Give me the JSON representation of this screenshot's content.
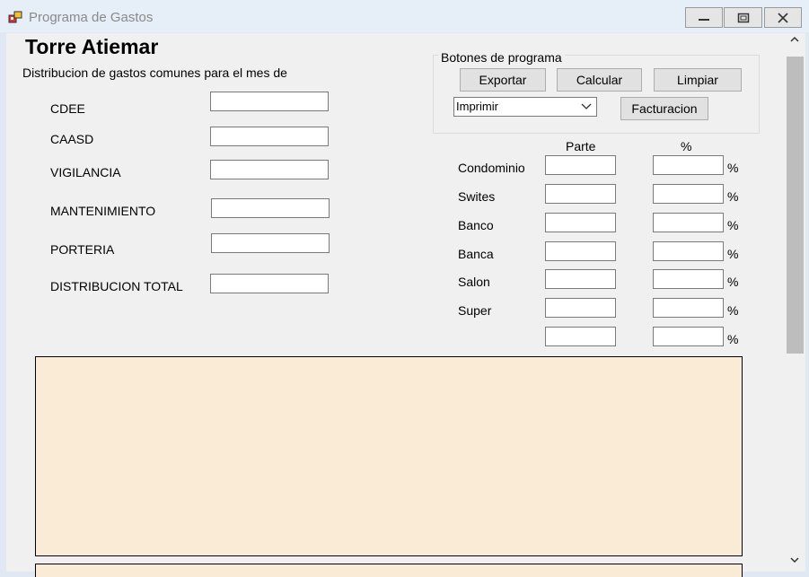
{
  "window": {
    "title": "Programa de Gastos"
  },
  "header": {
    "title": "Torre Atiemar",
    "subtitle": "Distribucion de gastos comunes para el mes de"
  },
  "gastos": [
    {
      "label": "CDEE",
      "value": ""
    },
    {
      "label": "CAASD",
      "value": ""
    },
    {
      "label": "VIGILANCIA",
      "value": ""
    },
    {
      "label": "MANTENIMIENTO",
      "value": ""
    },
    {
      "label": "PORTERIA",
      "value": ""
    },
    {
      "label": "DISTRIBUCION TOTAL",
      "value": ""
    }
  ],
  "program_group": {
    "title": "Botones de programa",
    "export_label": "Exportar",
    "calc_label": "Calcular",
    "clear_label": "Limpiar",
    "combo_value": "Imprimir",
    "billing_label": "Facturacion"
  },
  "distribution": {
    "col_parte": "Parte",
    "col_percent": "%",
    "percent_suffix": "%",
    "rows": [
      {
        "label": "Condominio",
        "parte": "",
        "percent": ""
      },
      {
        "label": "Swites",
        "parte": "",
        "percent": ""
      },
      {
        "label": "Banco",
        "parte": "",
        "percent": ""
      },
      {
        "label": "Banca",
        "parte": "",
        "percent": ""
      },
      {
        "label": "Salon",
        "parte": "",
        "percent": ""
      },
      {
        "label": "Super",
        "parte": "",
        "percent": ""
      },
      {
        "label": "",
        "parte": "",
        "percent": ""
      }
    ]
  },
  "colors": {
    "panel_bg": "#faebd7",
    "window_bg": "#f0f0f0"
  }
}
